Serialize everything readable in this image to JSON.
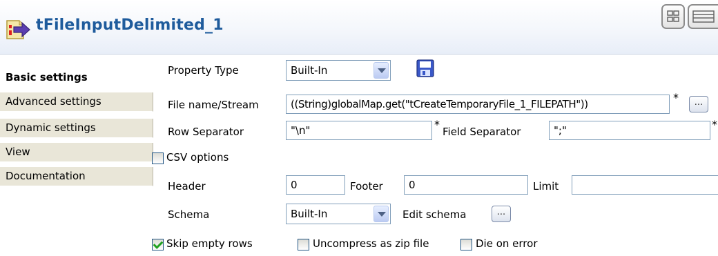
{
  "header": {
    "title": "tFileInputDelimited_1"
  },
  "sidebar": {
    "items": [
      {
        "label": "Basic settings",
        "active": true
      },
      {
        "label": "Advanced settings"
      },
      {
        "label": "Dynamic settings"
      },
      {
        "label": "View"
      },
      {
        "label": "Documentation"
      }
    ]
  },
  "form": {
    "property_type": {
      "label": "Property Type",
      "value": "Built-In"
    },
    "file_name": {
      "label": "File name/Stream",
      "value": "((String)globalMap.get(\"tCreateTemporaryFile_1_FILEPATH\"))",
      "required": "*",
      "browse_label": "..."
    },
    "row_separator": {
      "label": "Row Separator",
      "value": "\"\\n\"",
      "required": "*"
    },
    "field_separator": {
      "label": "Field Separator",
      "value": "\";\"",
      "required": "*"
    },
    "csv_options": {
      "label": "CSV options",
      "checked": false
    },
    "header": {
      "label": "Header",
      "value": "0"
    },
    "footer": {
      "label": "Footer",
      "value": "0"
    },
    "limit": {
      "label": "Limit",
      "value": ""
    },
    "schema": {
      "label": "Schema",
      "value": "Built-In"
    },
    "edit_schema": {
      "label": "Edit schema",
      "button_label": "..."
    },
    "skip_empty_rows": {
      "label": "Skip empty rows",
      "checked": true
    },
    "uncompress_zip": {
      "label": "Uncompress as zip file",
      "checked": false
    },
    "die_on_error": {
      "label": "Die on error",
      "checked": false
    }
  },
  "colors": {
    "title": "#1e5b9c",
    "sidebar_bg": "#e9e6d8",
    "field_border": "#7f9db9",
    "check_green": "#21a121"
  },
  "icons": [
    "component-arrow-icon",
    "save-icon",
    "layout-icon",
    "chevron-down-icon",
    "checkmark-icon"
  ]
}
